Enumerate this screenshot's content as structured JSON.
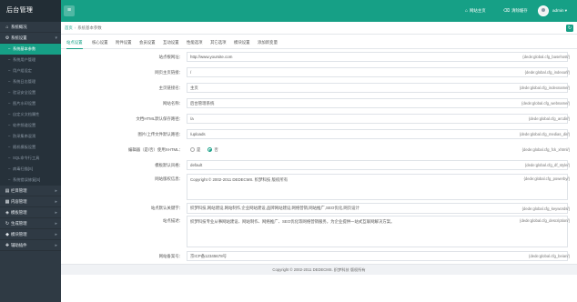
{
  "brand": "后台管理",
  "sidebar": {
    "top_item": "系统概况",
    "section": "系统设置",
    "sub_items": [
      "系统基本参数",
      "系统用户管理",
      "用户组设定",
      "系统日志管理",
      "验证安全设置",
      "图片水印设置",
      "自定义文档属性",
      "软件频道设置",
      "防采集串混淆",
      "随机模板设置",
      "SQL命令行工具",
      "病毒扫描[S]",
      "系统错误修复[S]"
    ],
    "groups": [
      "栏目管理",
      "内容管理",
      "模板管理",
      "生成管理",
      "模块管理",
      "辅助插件"
    ]
  },
  "topbar": {
    "links": [
      "网站主页",
      "清除缓存"
    ],
    "user": "admin"
  },
  "breadcrumb": [
    "首页",
    "系统基本参数"
  ],
  "tabs": [
    "站点设置",
    "核心设置",
    "附件设置",
    "会员设置",
    "互动设置",
    "性能选项",
    "其它选项",
    "模块设置",
    "添加新变量"
  ],
  "settings": [
    {
      "label": "站点根网址：",
      "value": "http://www.yoursite.com",
      "var": "{dede:global.cfg_basehost/}"
    },
    {
      "label": "网页主页链接：",
      "value": "/",
      "var": "{dede:global.cfg_indexurl/}"
    },
    {
      "label": "主页链接名：",
      "value": "主页",
      "var": "{dede:global.cfg_indexname/}"
    },
    {
      "label": "网站名称：",
      "value": "后台管理系统",
      "var": "{dede:global.cfg_webname/}"
    },
    {
      "label": "文档HTML默认保存路径：",
      "value": "/a",
      "var": "{dede:global.cfg_arcdir/}"
    },
    {
      "label": "图片/上传文件默认路径：",
      "value": "/uploads",
      "var": "{dede:global.cfg_medias_dir/}"
    },
    {
      "label": "编辑器（是/否）使用XHTML：",
      "value": "",
      "var": "{dede:global.cfg_fck_xhtml/}",
      "radios": [
        "是",
        "否"
      ],
      "selected": 1
    },
    {
      "label": "模板默认风格：",
      "value": "default",
      "var": "{dede:global.cfg_df_style/}"
    },
    {
      "label": "网站版权信息：",
      "value": "Copyright © 2002-2011 DEDECMS. 织梦科技 版权所有",
      "var": "{dede:global.cfg_powerby/}"
    },
    {
      "label": "站点默认关键字：",
      "value": "织梦科技,网站建设,网站制作,企业网站建设,品牌网站建设,网络营销,网站推广,SEO优化,网页设计",
      "var": "{dede:global.cfg_keywords/}"
    },
    {
      "label": "站点描述：",
      "value": "织梦科技专业从事网站建设、网站制作、网络推广、SEO优化等网络营销服务，为企业提供一站式互联网解决方案。",
      "var": "{dede:global.cfg_description/}"
    },
    {
      "label": "网站备案号：",
      "value": "京ICP备12345678号",
      "var": "{dede:global.cfg_beian/}"
    }
  ],
  "footer": "Copyright © 2002-2011 DEDECMS. 织梦科技 版权所有",
  "colors": {
    "accent": "#16a086",
    "sidebar": "#2f3a44",
    "brand_bg": "#222d35"
  }
}
